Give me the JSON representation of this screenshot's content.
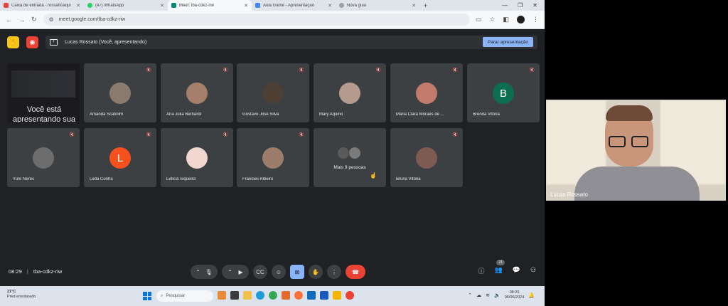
{
  "browser": {
    "tabs": [
      {
        "label": "Caixa de entrada - rossattoaqui",
        "color": "#ea4335",
        "active": false
      },
      {
        "label": "(47) WhatsApp",
        "color": "#25d366",
        "active": false
      },
      {
        "label": "Meet: tba-cdkz-riw",
        "color": "#00897b",
        "active": true
      },
      {
        "label": "Aula Game - Apresentação",
        "color": "#4285f4",
        "active": false
      },
      {
        "label": "Nova guia",
        "color": "#5f6368",
        "active": false
      }
    ],
    "url": "meet.google.com/tba-cdkz-riw"
  },
  "meet": {
    "presenting_banner": "Lucas Rossato (Você, apresentando)",
    "stop_presenting": "Parar apresentação",
    "you_tile_text": "Você está apresentando sua",
    "participants": [
      {
        "name": "Amanda Scatolim",
        "avatar": "photo",
        "color": "#8a7a70"
      },
      {
        "name": "Ana Júlia Bernardi",
        "avatar": "photo",
        "color": "#a57f6c"
      },
      {
        "name": "Gustavo Jose Silva",
        "avatar": "photo",
        "color": "#4d4037"
      },
      {
        "name": "Mary Aquino",
        "avatar": "photo",
        "color": "#b59a8e"
      },
      {
        "name": "Maria Clara Moraes de ...",
        "avatar": "photo",
        "color": "#c07b6a"
      },
      {
        "name": "Brenda Vitória",
        "avatar": "B",
        "color": "#0b6e4f"
      },
      {
        "name": "Yure Neres",
        "avatar": "photo",
        "color": "#6d6d6d"
      },
      {
        "name": "Leda Cunha",
        "avatar": "L",
        "color": "#f4511e"
      },
      {
        "name": "Leticia Siqueira",
        "avatar": "photo",
        "color": "#f2d6d0"
      },
      {
        "name": "Francieli Ribeiro",
        "avatar": "photo",
        "color": "#9c7d6b"
      },
      {
        "name": "Bruna Vitória",
        "avatar": "photo",
        "color": "#7d5a52"
      }
    ],
    "more_people": "Mais 9 pessoas",
    "time": "08:29",
    "meeting_code": "tba-cdkz-riw",
    "participant_count": "21",
    "speaker_name": "Lucas Rossato"
  },
  "taskbar": {
    "temperature": "21°C",
    "weather_desc": "Pred ensolarado",
    "search_placeholder": "Pesquisar",
    "time": "08:29",
    "date": "06/06/2024"
  }
}
